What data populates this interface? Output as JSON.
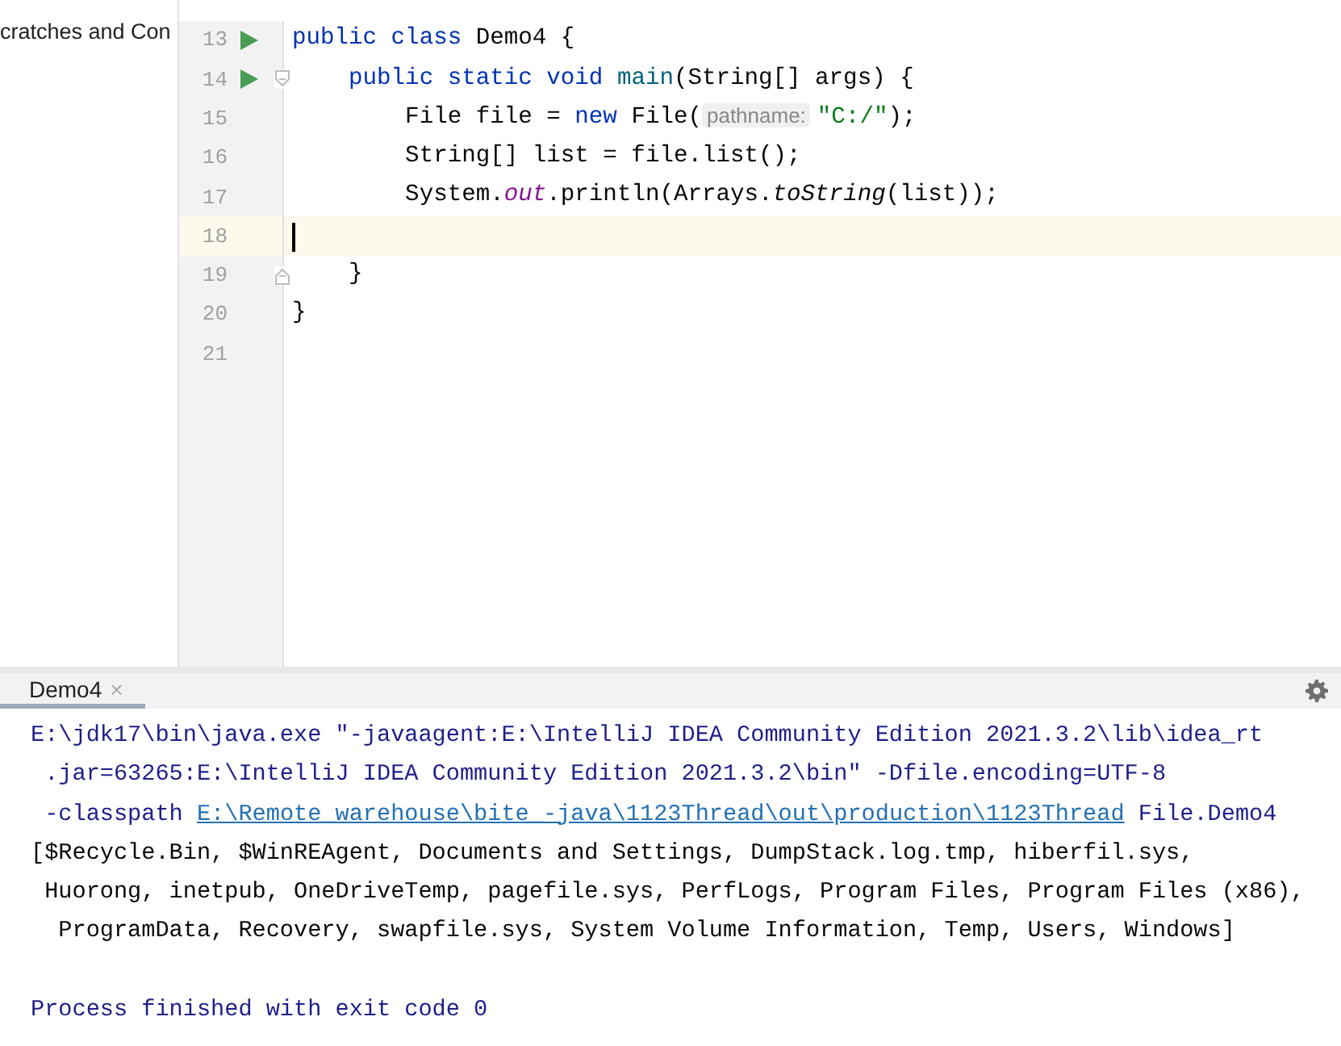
{
  "project_tree": [
    {
      "label": "cratches and Con"
    }
  ],
  "editor": {
    "lines": [
      {
        "number": "13",
        "run": true,
        "fold_start": false,
        "fold_end": false,
        "current": false,
        "tokens": [
          {
            "kind": "keyword",
            "text": "public class "
          },
          {
            "kind": "plain",
            "text": "Demo4 {"
          }
        ]
      },
      {
        "number": "14",
        "run": true,
        "fold_start": true,
        "fold_end": false,
        "current": false,
        "tokens": [
          {
            "kind": "keyword",
            "text": "    public static void "
          },
          {
            "kind": "method",
            "text": "main"
          },
          {
            "kind": "plain",
            "text": "(String[] args) {"
          }
        ]
      },
      {
        "number": "15",
        "run": false,
        "fold_start": false,
        "fold_end": false,
        "current": false,
        "tokens": [
          {
            "kind": "plain",
            "text": "        File file = "
          },
          {
            "kind": "keyword",
            "text": "new "
          },
          {
            "kind": "plain",
            "text": "File("
          },
          {
            "kind": "hint",
            "text": "pathname:"
          },
          {
            "kind": "string",
            "text": "\"C:/\""
          },
          {
            "kind": "plain",
            "text": ");"
          }
        ]
      },
      {
        "number": "16",
        "run": false,
        "fold_start": false,
        "fold_end": false,
        "current": false,
        "tokens": [
          {
            "kind": "plain",
            "text": "        String[] list = file.list();"
          }
        ]
      },
      {
        "number": "17",
        "run": false,
        "fold_start": false,
        "fold_end": false,
        "current": false,
        "tokens": [
          {
            "kind": "plain",
            "text": "        System."
          },
          {
            "kind": "field",
            "text": "out"
          },
          {
            "kind": "plain",
            "text": ".println(Arrays."
          },
          {
            "kind": "static_method",
            "text": "toString"
          },
          {
            "kind": "plain",
            "text": "(list));"
          }
        ]
      },
      {
        "number": "18",
        "run": false,
        "fold_start": false,
        "fold_end": false,
        "current": true
      },
      {
        "number": "19",
        "run": false,
        "fold_start": false,
        "fold_end": true,
        "current": false,
        "tokens": [
          {
            "kind": "plain",
            "text": "    }"
          }
        ]
      },
      {
        "number": "20",
        "run": false,
        "fold_start": false,
        "fold_end": false,
        "current": false,
        "tokens": [
          {
            "kind": "plain",
            "text": "}"
          }
        ]
      },
      {
        "number": "21",
        "run": false,
        "fold_start": false,
        "fold_end": false,
        "current": false
      }
    ]
  },
  "console": {
    "tab": {
      "label": "Demo4",
      "close": "×",
      "selected": true
    },
    "lines": [
      {
        "kind": "command",
        "segments": [
          {
            "text": "E:\\jdk17\\bin\\java.exe \"-javaagent:E:\\IntelliJ IDEA Community Edition 2021.3.2\\lib\\idea_rt",
            "link": false
          }
        ]
      },
      {
        "kind": "command",
        "segments": [
          {
            "text": " .jar=63265:E:\\IntelliJ IDEA Community Edition 2021.3.2\\bin\" -Dfile.encoding=UTF-8",
            "link": false
          }
        ]
      },
      {
        "kind": "command",
        "segments": [
          {
            "text": " -classpath ",
            "link": false
          },
          {
            "text": "E:\\Remote_warehouse\\bite_-java\\1123Thread\\out\\production\\1123Thread",
            "link": true
          },
          {
            "text": " File.Demo4",
            "link": false
          }
        ]
      },
      {
        "kind": "output",
        "segments": [
          {
            "text": "[$Recycle.Bin, $WinREAgent, Documents and Settings, DumpStack.log.tmp, hiberfil.sys,",
            "link": false
          }
        ]
      },
      {
        "kind": "output",
        "segments": [
          {
            "text": " Huorong, inetpub, OneDriveTemp, pagefile.sys, PerfLogs, Program Files, Program Files (x86),",
            "link": false
          }
        ]
      },
      {
        "kind": "output",
        "segments": [
          {
            "text": "  ProgramData, Recovery, swapfile.sys, System Volume Information, Temp, Users, Windows]",
            "link": false
          }
        ]
      },
      {
        "kind": "blank"
      },
      {
        "kind": "command",
        "segments": [
          {
            "text": "Process finished with exit code 0",
            "link": false
          }
        ]
      }
    ]
  }
}
